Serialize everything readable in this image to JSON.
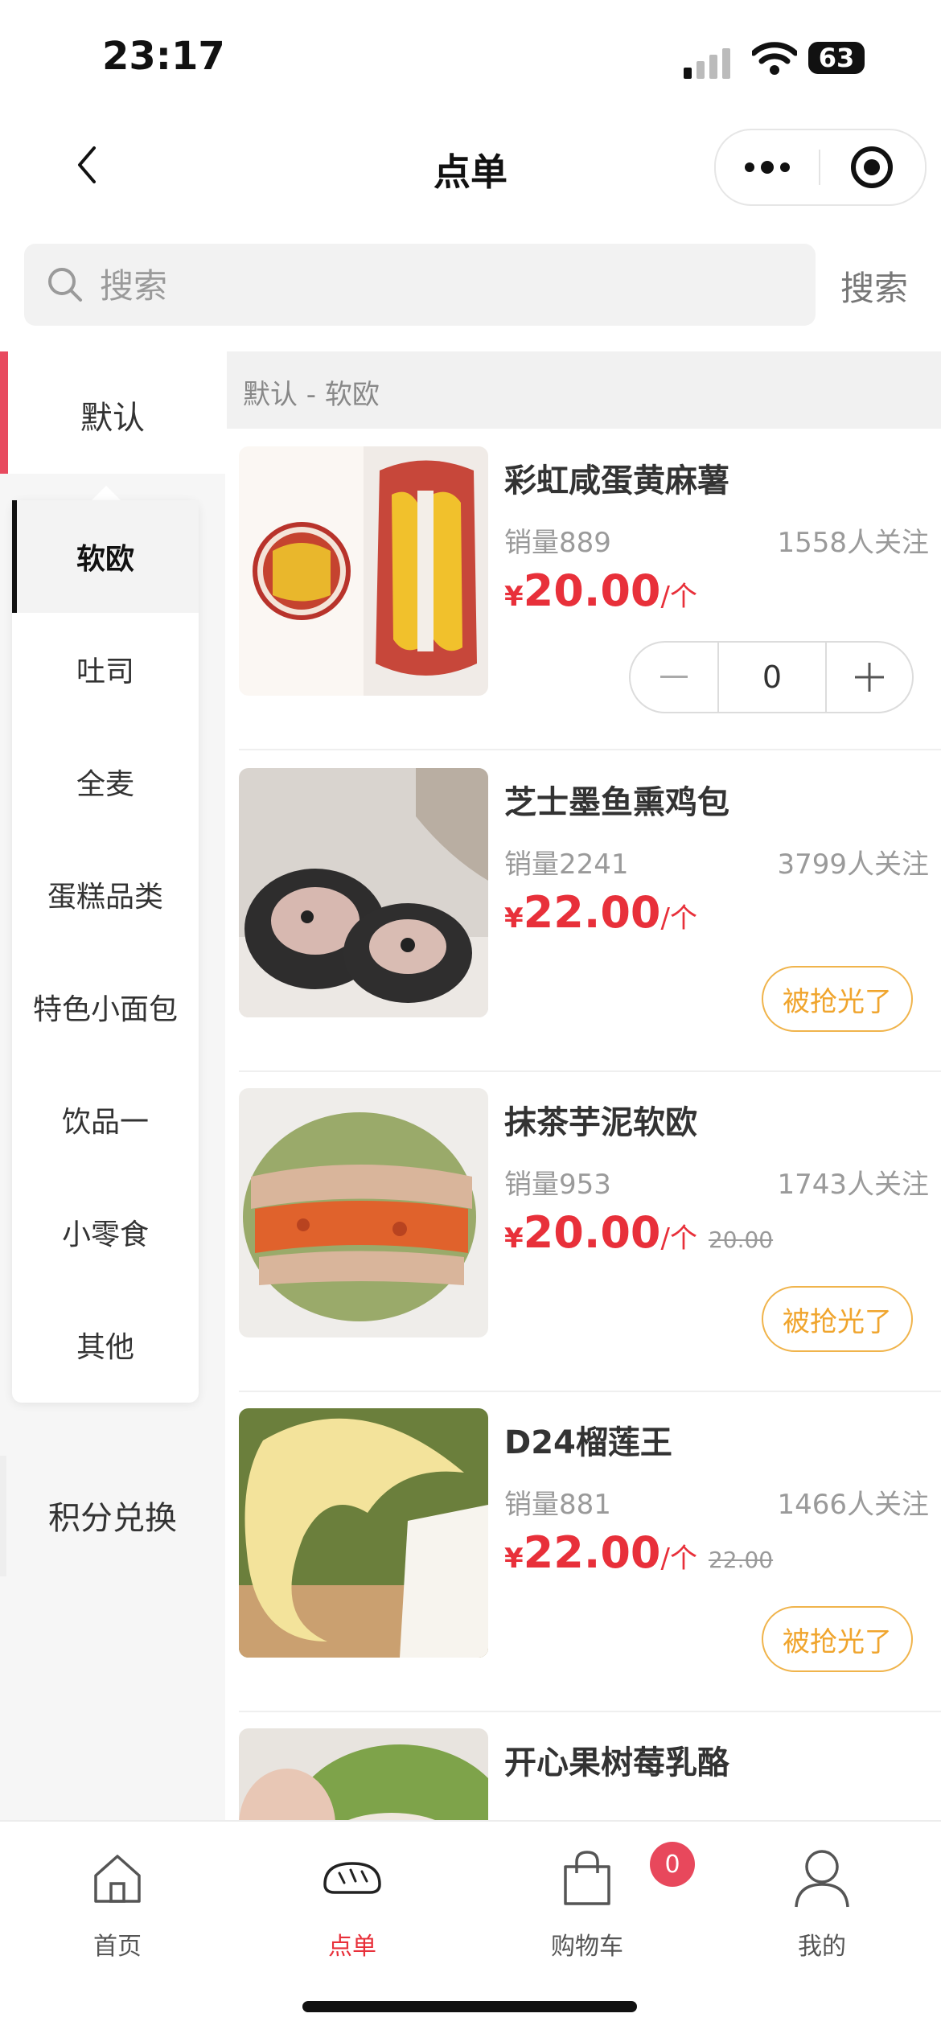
{
  "status_bar": {
    "time": "23:17",
    "battery": "63"
  },
  "nav": {
    "title": "点单"
  },
  "search": {
    "placeholder": "搜索",
    "button_label": "搜索"
  },
  "sidebar": {
    "default_label": "默认",
    "sub_items": [
      "软欧",
      "吐司",
      "全麦",
      "蛋糕品类",
      "特色小面包",
      "饮品一",
      "小零食",
      "其他"
    ],
    "active_sub": "软欧",
    "points_label": "积分兑换"
  },
  "section": {
    "header": "默认 - 软欧"
  },
  "products": [
    {
      "name": "彩虹咸蛋黄麻薯",
      "sales": "销量889",
      "followers": "1558人关注",
      "currency": "¥",
      "price": "20.00",
      "unit": "/个",
      "original_price": "",
      "action": "stepper",
      "quantity": "0"
    },
    {
      "name": "芝士墨鱼熏鸡包",
      "sales": "销量2241",
      "followers": "3799人关注",
      "currency": "¥",
      "price": "22.00",
      "unit": "/个",
      "original_price": "",
      "action": "soldout",
      "soldout_label": "被抢光了"
    },
    {
      "name": "抹茶芋泥软欧",
      "sales": "销量953",
      "followers": "1743人关注",
      "currency": "¥",
      "price": "20.00",
      "unit": "/个",
      "original_price": "20.00",
      "action": "soldout",
      "soldout_label": "被抢光了"
    },
    {
      "name": "D24榴莲王",
      "sales": "销量881",
      "followers": "1466人关注",
      "currency": "¥",
      "price": "22.00",
      "unit": "/个",
      "original_price": "22.00",
      "action": "soldout",
      "soldout_label": "被抢光了"
    },
    {
      "name": "开心果树莓乳酪"
    }
  ],
  "tabbar": {
    "tabs": [
      {
        "label": "首页",
        "icon": "home-icon"
      },
      {
        "label": "点单",
        "icon": "bread-icon",
        "active": true
      },
      {
        "label": "购物车",
        "icon": "shopping-bag-icon"
      },
      {
        "label": "我的",
        "icon": "user-icon"
      }
    ],
    "cart_badge": "0"
  },
  "colors": {
    "accent": "#e8303a",
    "sidebar_accent": "#e84a5f",
    "soldout": "#f0a52e",
    "badge": "#e8485c"
  }
}
